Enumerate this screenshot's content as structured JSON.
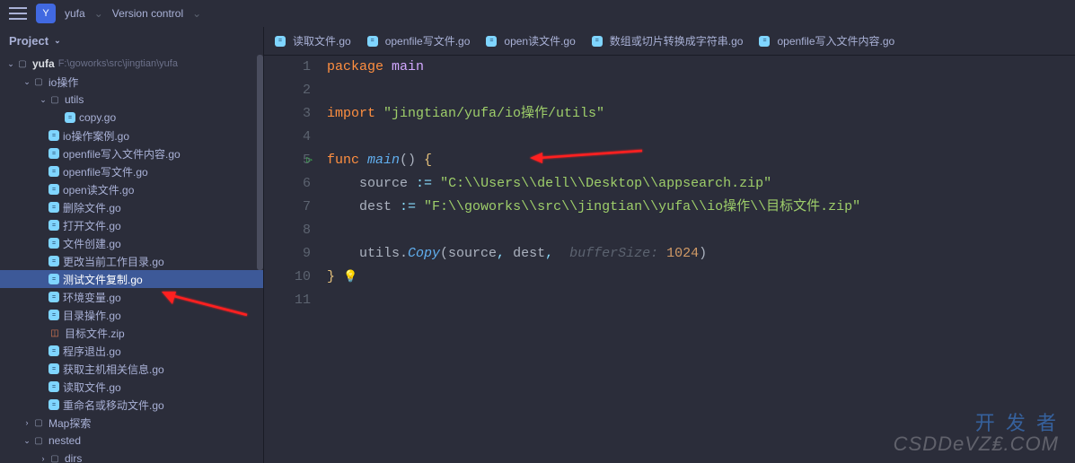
{
  "toolbar": {
    "project_short": "Y",
    "project_name": "yufa",
    "vc_label": "Version control"
  },
  "sidebar": {
    "title": "Project",
    "root": {
      "name": "yufa",
      "path": "F:\\goworks\\src\\jingtian\\yufa"
    },
    "tree": [
      {
        "depth": 1,
        "type": "folder",
        "name": "io操作",
        "expanded": true
      },
      {
        "depth": 2,
        "type": "folder",
        "name": "utils",
        "expanded": true
      },
      {
        "depth": 3,
        "type": "go",
        "name": "copy.go"
      },
      {
        "depth": 2,
        "type": "go",
        "name": "io操作案例.go"
      },
      {
        "depth": 2,
        "type": "go",
        "name": "openfile写入文件内容.go"
      },
      {
        "depth": 2,
        "type": "go",
        "name": "openfile写文件.go"
      },
      {
        "depth": 2,
        "type": "go",
        "name": "open读文件.go"
      },
      {
        "depth": 2,
        "type": "go",
        "name": "删除文件.go"
      },
      {
        "depth": 2,
        "type": "go",
        "name": "打开文件.go"
      },
      {
        "depth": 2,
        "type": "go",
        "name": "文件创建.go"
      },
      {
        "depth": 2,
        "type": "go",
        "name": "更改当前工作目录.go"
      },
      {
        "depth": 2,
        "type": "go",
        "name": "测试文件复制.go",
        "selected": true
      },
      {
        "depth": 2,
        "type": "go",
        "name": "环境变量.go"
      },
      {
        "depth": 2,
        "type": "go",
        "name": "目录操作.go"
      },
      {
        "depth": 2,
        "type": "zip",
        "name": "目标文件.zip"
      },
      {
        "depth": 2,
        "type": "go",
        "name": "程序退出.go"
      },
      {
        "depth": 2,
        "type": "go",
        "name": "获取主机相关信息.go"
      },
      {
        "depth": 2,
        "type": "go",
        "name": "读取文件.go"
      },
      {
        "depth": 2,
        "type": "go",
        "name": "重命名或移动文件.go"
      },
      {
        "depth": 1,
        "type": "folder",
        "name": "Map探索",
        "expanded": false
      },
      {
        "depth": 1,
        "type": "folder",
        "name": "nested",
        "expanded": true
      },
      {
        "depth": 2,
        "type": "folder",
        "name": "dirs",
        "expanded": false
      }
    ]
  },
  "tabs": [
    {
      "name": "读取文件.go"
    },
    {
      "name": "openfile写文件.go"
    },
    {
      "name": "open读文件.go"
    },
    {
      "name": "数组或切片转换成字符串.go"
    },
    {
      "name": "openfile写入文件内容.go"
    }
  ],
  "code": {
    "lines": [
      {
        "n": 1,
        "seg": [
          [
            "k",
            "package "
          ],
          [
            "pkg",
            "main"
          ]
        ]
      },
      {
        "n": 2,
        "seg": []
      },
      {
        "n": 3,
        "seg": [
          [
            "k",
            "import "
          ],
          [
            "s",
            "\"jingtian/yufa/io操作/utils\""
          ]
        ]
      },
      {
        "n": 4,
        "seg": []
      },
      {
        "n": 5,
        "run": true,
        "seg": [
          [
            "k",
            "func "
          ],
          [
            "fn",
            "main"
          ],
          [
            "w",
            "() "
          ],
          [
            "br",
            "{"
          ]
        ]
      },
      {
        "n": 6,
        "seg": [
          [
            "w",
            "    source "
          ],
          [
            "op",
            ":="
          ],
          [
            "w",
            " "
          ],
          [
            "s",
            "\"C:\\\\Users\\\\dell\\\\Desktop\\\\appsearch.zip\""
          ]
        ]
      },
      {
        "n": 7,
        "seg": [
          [
            "w",
            "    dest "
          ],
          [
            "op",
            ":="
          ],
          [
            "w",
            " "
          ],
          [
            "s",
            "\"F:\\\\goworks\\\\src\\\\jingtian\\\\yufa\\\\io操作\\\\目标文件.zip\""
          ]
        ]
      },
      {
        "n": 8,
        "seg": []
      },
      {
        "n": 9,
        "seg": [
          [
            "w",
            "    utils."
          ],
          [
            "fn",
            "Copy"
          ],
          [
            "w",
            "(source"
          ],
          [
            "op",
            ", "
          ],
          [
            "w",
            "dest"
          ],
          [
            "op",
            ", "
          ],
          [
            "param",
            " bufferSize: "
          ],
          [
            "num",
            "1024"
          ],
          [
            "w",
            ")"
          ]
        ]
      },
      {
        "n": 10,
        "bulb": true,
        "seg": [
          [
            "br",
            "}"
          ]
        ]
      },
      {
        "n": 11,
        "hl": true,
        "seg": []
      }
    ]
  },
  "watermark": {
    "line1": "开 发 者",
    "line2": "CSDDeVZ₤.COM"
  }
}
